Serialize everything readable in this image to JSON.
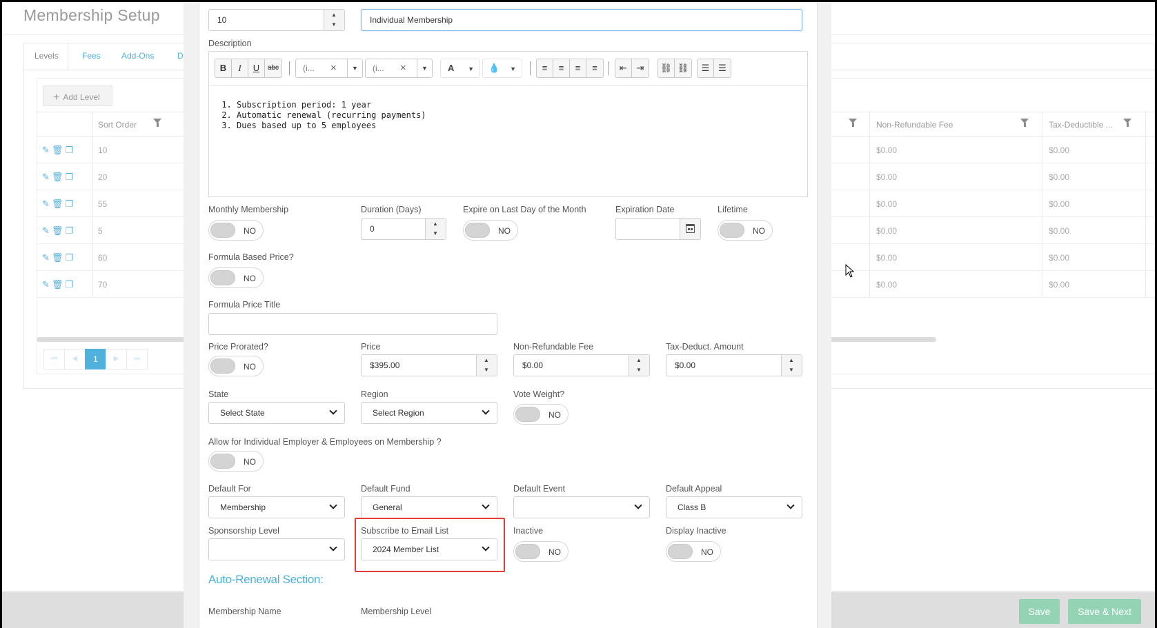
{
  "page": {
    "title": "Membership Setup"
  },
  "tabs": [
    {
      "label": "Levels"
    },
    {
      "label": "Fees"
    },
    {
      "label": "Add-Ons"
    },
    {
      "label": "D"
    }
  ],
  "grid": {
    "add_label": "Add Level",
    "headers": {
      "sort_order": "Sort Order",
      "non_refundable_fee": "Non-Refundable Fee",
      "tax_deductible": "Tax-Deductible ..."
    },
    "rows": [
      {
        "sort": "10",
        "fee": "$0.00",
        "tax": "$0.00"
      },
      {
        "sort": "20",
        "fee": "$0.00",
        "tax": "$0.00"
      },
      {
        "sort": "55",
        "fee": "$0.00",
        "tax": "$0.00"
      },
      {
        "sort": "5",
        "fee": "$0.00",
        "tax": "$0.00"
      },
      {
        "sort": "60",
        "fee": "$0.00",
        "tax": "$0.00"
      },
      {
        "sort": "70",
        "fee": "$0.00",
        "tax": "$0.00"
      }
    ],
    "pager": {
      "current": "1"
    }
  },
  "footer": {
    "save": "Save",
    "save_next": "Save & Next"
  },
  "form": {
    "sort_value": "10",
    "name_value": "Individual Membership",
    "description_label": "Description",
    "toolbar": {
      "font_combo": "(i...",
      "size_combo": "(i...",
      "font_color": "A"
    },
    "description_items": [
      "Subscription period: 1 year",
      "Automatic renewal (recurring payments)",
      "Dues based up to 5 employees"
    ],
    "monthly_label": "Monthly Membership",
    "duration_label": "Duration (Days)",
    "duration_value": "0",
    "expire_last_day_label": "Expire on Last Day of the Month",
    "expiration_date_label": "Expiration Date",
    "lifetime_label": "Lifetime",
    "formula_based_label": "Formula Based Price?",
    "formula_title_label": "Formula Price Title",
    "price_prorated_label": "Price Prorated?",
    "price_label": "Price",
    "price_value": "$395.00",
    "nonref_label": "Non-Refundable Fee",
    "nonref_value": "$0.00",
    "taxded_label": "Tax-Deduct. Amount",
    "taxded_value": "$0.00",
    "state_label": "State",
    "state_value": "Select State",
    "region_label": "Region",
    "region_value": "Select Region",
    "vote_weight_label": "Vote Weight?",
    "allow_individual_label": "Allow for Individual Employer & Employees on Membership ?",
    "default_for_label": "Default For",
    "default_for_value": "Membership",
    "default_fund_label": "Default Fund",
    "default_fund_value": "General",
    "default_event_label": "Default Event",
    "default_event_value": "",
    "default_appeal_label": "Default Appeal",
    "default_appeal_value": "Class B",
    "sponsorship_label": "Sponsorship Level",
    "sponsorship_value": "",
    "subscribe_label": "Subscribe to Email List",
    "subscribe_value": "2024 Member List",
    "inactive_label": "Inactive",
    "display_inactive_label": "Display Inactive",
    "auto_renewal_title": "Auto-Renewal Section:",
    "membership_name_label": "Membership Name",
    "membership_level_label": "Membership Level",
    "toggle_no": "NO"
  }
}
